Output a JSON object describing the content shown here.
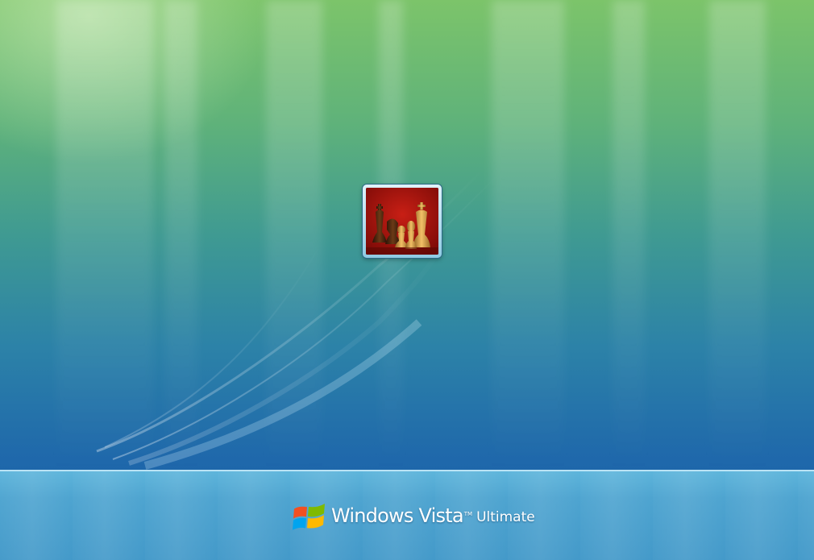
{
  "screen": {
    "type": "logon",
    "background_colors": {
      "top": "#7cc46a",
      "middle": "#2c82a8",
      "bottom": "#1a5fa6",
      "floor": "#4aa2cf"
    }
  },
  "user_tile": {
    "picture_icon": "chess-pieces-picture",
    "picture_background": "#a8150f"
  },
  "branding": {
    "logo_icon": "windows-flag-icon",
    "flag_colors": [
      "#f25022",
      "#7fba00",
      "#00a4ef",
      "#ffb900"
    ],
    "name_part1": "Windows",
    "name_part2": "Vista",
    "trademark": "TM",
    "edition": "Ultimate"
  }
}
